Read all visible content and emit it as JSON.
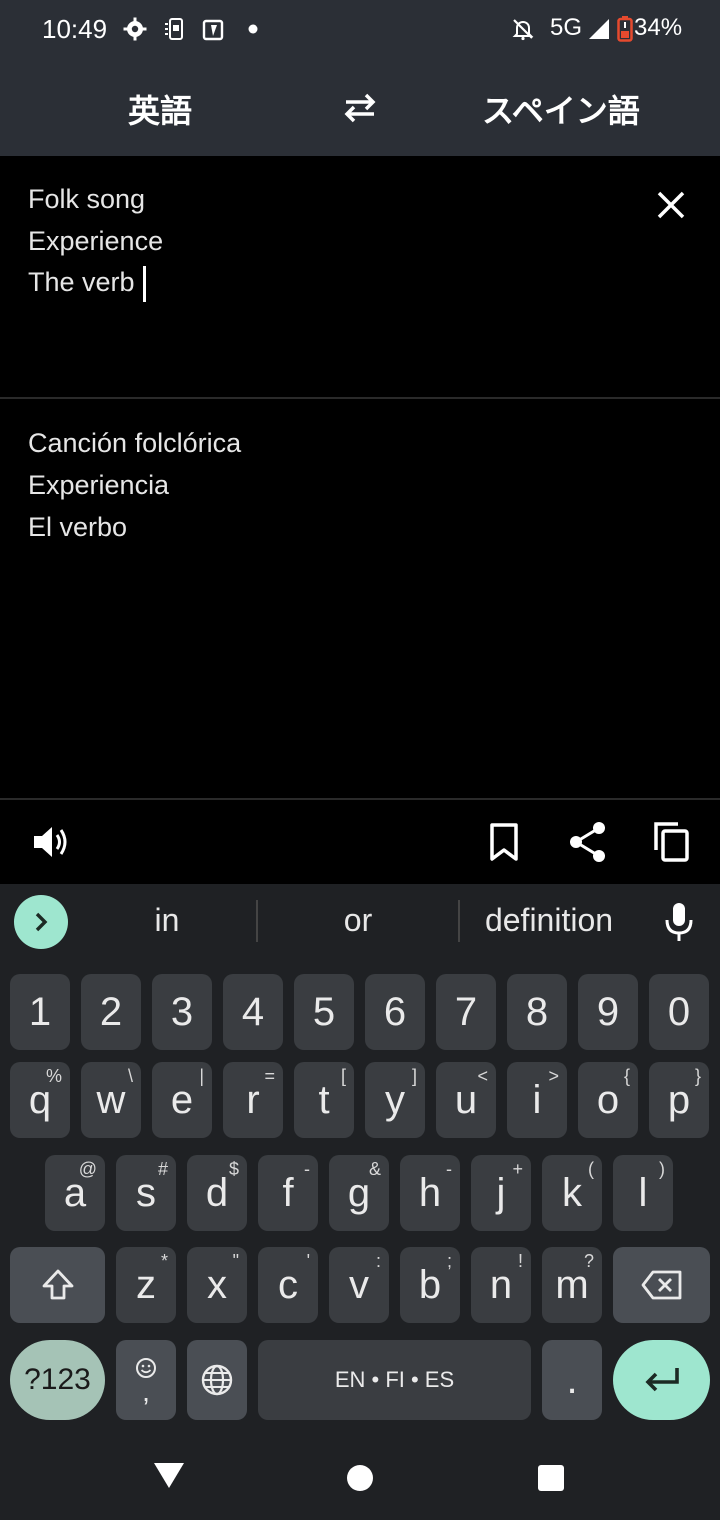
{
  "status_bar": {
    "time": "10:49",
    "network": "5G",
    "battery": "34%",
    "icons": [
      "gear-icon",
      "sim-icon",
      "clipboard-icon",
      "dot-icon",
      "mute-icon",
      "signal-icon",
      "battery-icon"
    ]
  },
  "header": {
    "source_language": "英語",
    "target_language": "スペイン語",
    "swap_icon": "swap-icon"
  },
  "input": {
    "lines": [
      "Folk song",
      "Experience",
      "The verb"
    ]
  },
  "output": {
    "lines": [
      "Canción folclórica",
      "Experiencia",
      "El verbo"
    ]
  },
  "actions": {
    "icons": [
      "speaker-icon",
      "bookmark-icon",
      "share-icon",
      "copy-icon"
    ]
  },
  "keyboard": {
    "suggestions": [
      "in",
      "or",
      "definition"
    ],
    "numbers": [
      "1",
      "2",
      "3",
      "4",
      "5",
      "6",
      "7",
      "8",
      "9",
      "0"
    ],
    "row1": [
      {
        "k": "q",
        "s": "%"
      },
      {
        "k": "w",
        "s": "\\"
      },
      {
        "k": "e",
        "s": "|"
      },
      {
        "k": "r",
        "s": "="
      },
      {
        "k": "t",
        "s": "["
      },
      {
        "k": "y",
        "s": "]"
      },
      {
        "k": "u",
        "s": "<"
      },
      {
        "k": "i",
        "s": ">"
      },
      {
        "k": "o",
        "s": "{"
      },
      {
        "k": "p",
        "s": "}"
      }
    ],
    "row2": [
      {
        "k": "a",
        "s": "@"
      },
      {
        "k": "s",
        "s": "#"
      },
      {
        "k": "d",
        "s": "$"
      },
      {
        "k": "f",
        "s": "-"
      },
      {
        "k": "g",
        "s": "&"
      },
      {
        "k": "h",
        "s": "-"
      },
      {
        "k": "j",
        "s": "+"
      },
      {
        "k": "k",
        "s": "("
      },
      {
        "k": "l",
        "s": ")"
      }
    ],
    "row3": [
      {
        "k": "z",
        "s": "*"
      },
      {
        "k": "x",
        "s": "\""
      },
      {
        "k": "c",
        "s": "'"
      },
      {
        "k": "v",
        "s": ":"
      },
      {
        "k": "b",
        "s": ";"
      },
      {
        "k": "n",
        "s": "!"
      },
      {
        "k": "m",
        "s": "?"
      }
    ],
    "symbols_label": "?123",
    "comma_label": ",",
    "space_label": "EN • FI • ES",
    "period_label": ".",
    "accent_color": "#9ee6cf"
  },
  "nav_bar": {
    "icons": [
      "back-icon",
      "home-icon",
      "recents-icon"
    ]
  }
}
